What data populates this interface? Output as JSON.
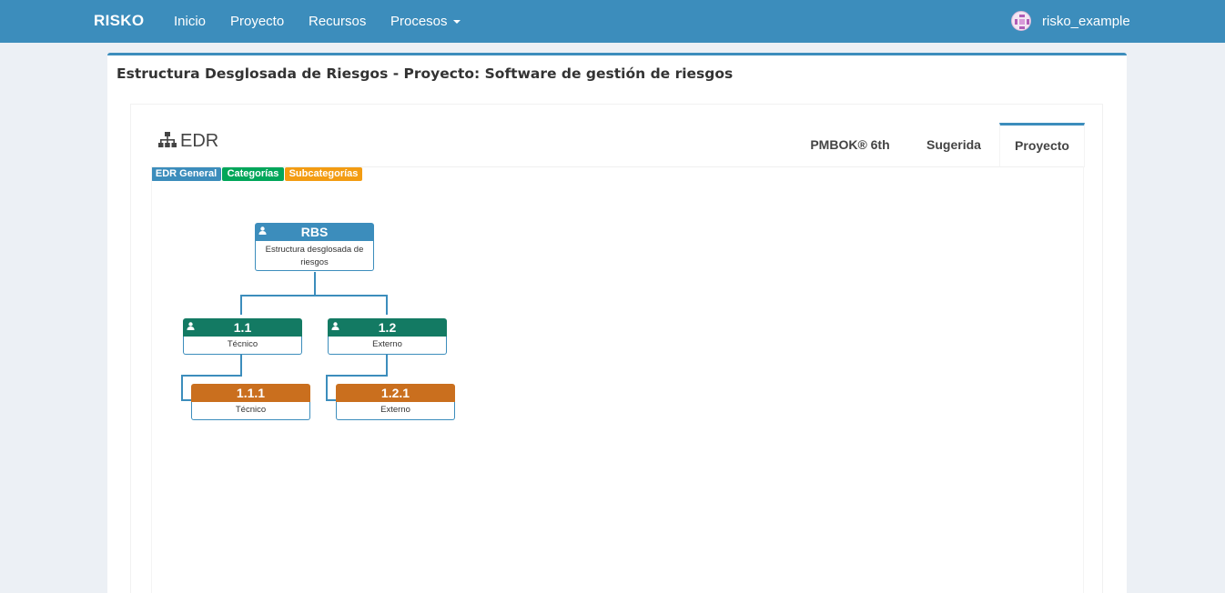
{
  "navbar": {
    "brand": "RISKO",
    "links": [
      "Inicio",
      "Proyecto",
      "Recursos",
      "Procesos"
    ],
    "user": "risko_example"
  },
  "page": {
    "title": "Estructura Desglosada de Riesgos - Proyecto: Software de gestión de riesgos"
  },
  "panel": {
    "header": "EDR",
    "tabs": [
      "PMBOK® 6th",
      "Sugerida",
      "Proyecto"
    ],
    "active_tab": "Proyecto",
    "legend": [
      {
        "label": "EDR General",
        "color": "#3c8dbc"
      },
      {
        "label": "Categorías",
        "color": "#00a65a"
      },
      {
        "label": "Subcategorías",
        "color": "#f39c12"
      }
    ]
  },
  "tree": {
    "root": {
      "code": "RBS",
      "desc": "Estructura desglosada de riesgos",
      "color": "#3c8dbc"
    },
    "categories": [
      {
        "code": "1.1",
        "desc": "Técnico",
        "color": "#137a63"
      },
      {
        "code": "1.2",
        "desc": "Externo",
        "color": "#137a63"
      }
    ],
    "subcategories": [
      {
        "code": "1.1.1",
        "desc": "Técnico",
        "color": "#ca6f1e"
      },
      {
        "code": "1.2.1",
        "desc": "Externo",
        "color": "#ca6f1e"
      }
    ]
  }
}
